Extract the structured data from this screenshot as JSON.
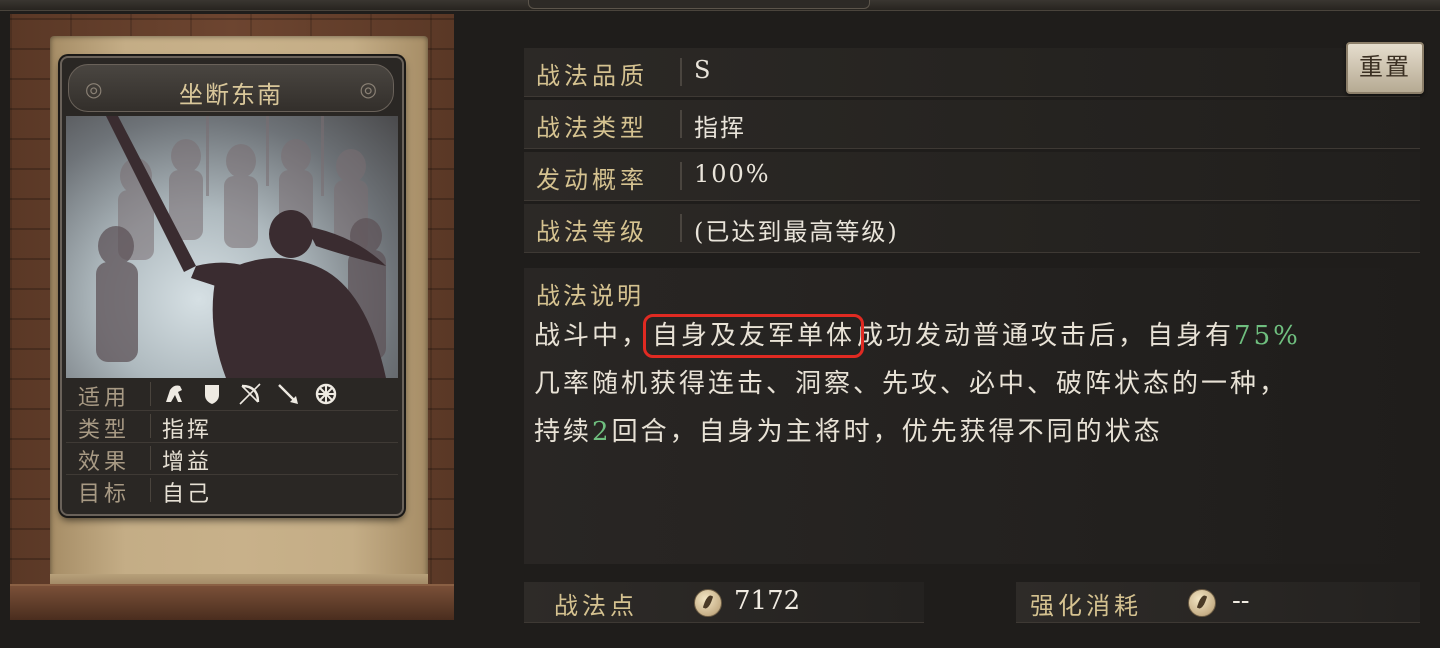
{
  "skill_card": {
    "name": "坐断东南",
    "stats": [
      {
        "label": "适用",
        "icons": [
          "cavalry-icon",
          "shield-icon",
          "bow-icon",
          "spear-icon",
          "wheel-icon"
        ]
      },
      {
        "label": "类型",
        "value": "指挥"
      },
      {
        "label": "效果",
        "value": "增益"
      },
      {
        "label": "目标",
        "value": "自己"
      }
    ]
  },
  "details": {
    "reset_label": "重置",
    "rows": [
      {
        "label": "战法品质",
        "value": "S"
      },
      {
        "label": "战法类型",
        "value": "指挥"
      },
      {
        "label": "发动概率",
        "value": "100%"
      },
      {
        "label": "战法等级",
        "value": "(已达到最高等级)"
      }
    ],
    "description_title": "战法说明",
    "description": {
      "line1_prefix": "战斗中，",
      "line1_highlight": "自身及友军单体",
      "line1_mid": "成功发动普通攻击后，自身有",
      "line1_pct": "75%",
      "line2": "几率随机获得连击、洞察、先攻、必中、破阵状态的一种，",
      "line3_prefix": "持续",
      "line3_num": "2",
      "line3_suffix": "回合，自身为主将时，优先获得不同的状态"
    }
  },
  "footer": {
    "points_label": "战法点",
    "points_value": "7172",
    "cost_label": "强化消耗",
    "cost_value": "--"
  },
  "colors": {
    "gold_label": "#d5c290",
    "green_value": "#6fbf7f",
    "highlight_box": "#e02a22"
  }
}
